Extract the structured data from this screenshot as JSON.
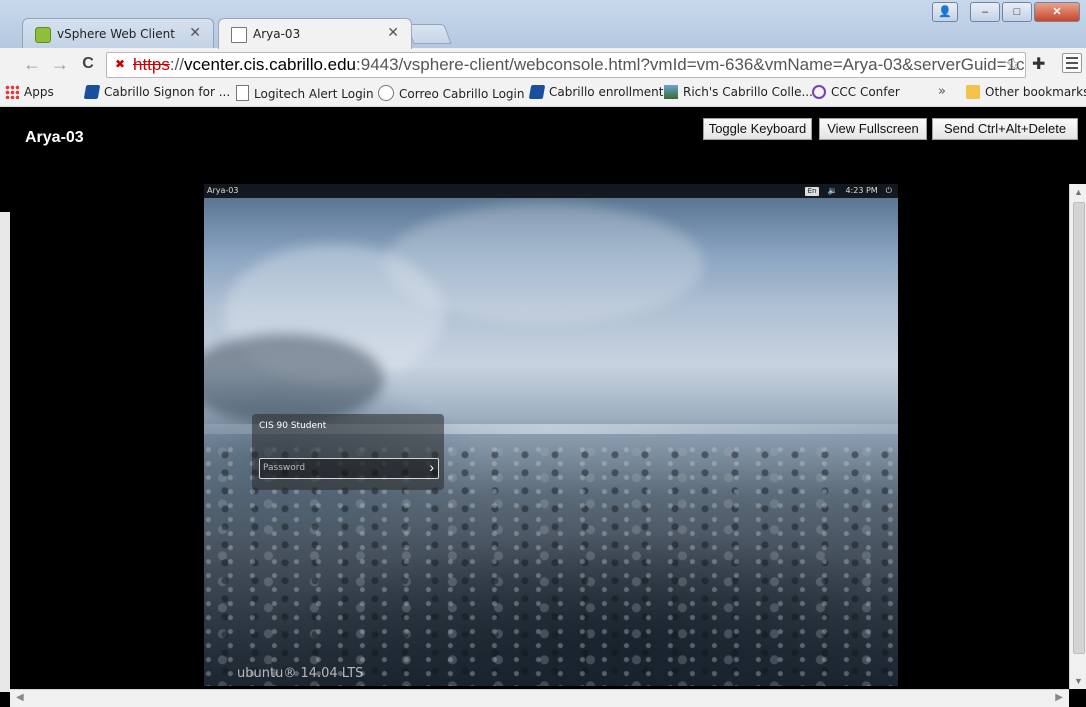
{
  "browser": {
    "tabs": [
      {
        "label": "vSphere Web Client",
        "active": false,
        "favicon": "vsphere-icon"
      },
      {
        "label": "Arya-03",
        "active": true,
        "favicon": "page-icon"
      }
    ],
    "url": {
      "scheme": "https",
      "separator": "://",
      "host": "vcenter.cis.cabrillo.edu",
      "path": ":9443/vsphere-client/webconsole.html?vmId=vm-636&vmName=Arya-03&serverGuid=1c"
    },
    "bookmarks": [
      {
        "label": "Apps",
        "icon": "apps-grid-icon"
      },
      {
        "label": "Cabrillo Signon for ...",
        "icon": "cabrillo-icon"
      },
      {
        "label": "Logitech Alert Login",
        "icon": "page-icon"
      },
      {
        "label": "Correo Cabrillo Login",
        "icon": "correo-icon"
      },
      {
        "label": "Cabrillo enrollment",
        "icon": "cabrillo-icon"
      },
      {
        "label": "Rich's Cabrillo Colle...",
        "icon": "photo-icon"
      },
      {
        "label": "CCC Confer",
        "icon": "ccc-icon"
      }
    ],
    "overflow_label": "»",
    "other_bookmarks": "Other bookmarks"
  },
  "console": {
    "vm_name": "Arya-03",
    "buttons": {
      "toggle_keyboard": "Toggle Keyboard",
      "view_fullscreen": "View Fullscreen",
      "send_cad": "Send Ctrl+Alt+Delete"
    }
  },
  "vm": {
    "topbar_name": "Arya-03",
    "keyboard_layout": "En",
    "volume_icon": "🔉",
    "clock": "4:23 PM",
    "power_icon": "⏻",
    "login": {
      "user": "CIS 90 Student",
      "password_placeholder": "Password"
    },
    "brand": "ubuntu® 14.04 LTS"
  }
}
